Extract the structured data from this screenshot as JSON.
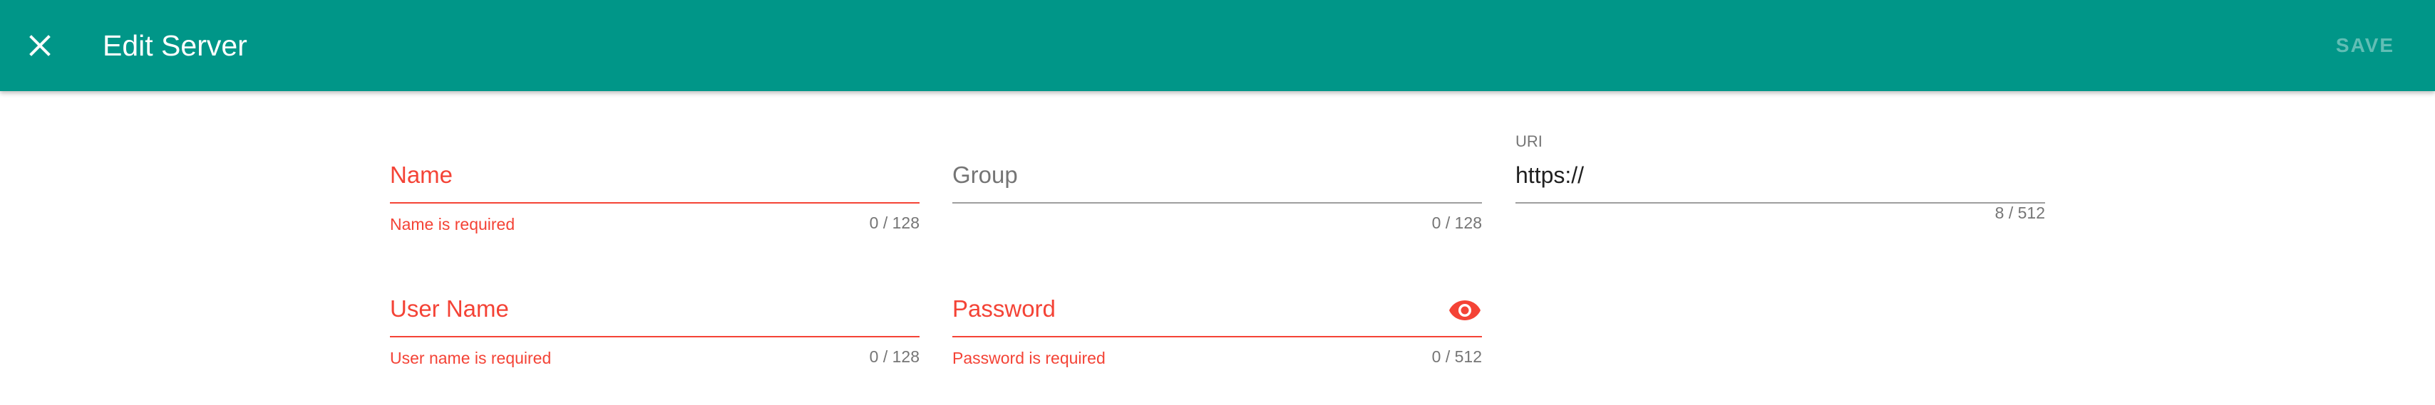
{
  "colors": {
    "toolbar": "#009688",
    "error": "#f44336",
    "label": "#757575",
    "text": "#212121"
  },
  "toolbar": {
    "close_icon": "close-icon",
    "title": "Edit Server",
    "save_label": "SAVE"
  },
  "form": {
    "name": {
      "label": "Name",
      "value": "",
      "error": "Name is required",
      "counter": "0 / 128"
    },
    "group": {
      "label": "Group",
      "value": "",
      "counter": "0 / 128"
    },
    "uri": {
      "label": "URI",
      "value": "https://",
      "counter": "8 / 512"
    },
    "username": {
      "label": "User Name",
      "value": "",
      "error": "User name is required",
      "counter": "0 / 128"
    },
    "password": {
      "label": "Password",
      "value": "",
      "error": "Password is required",
      "counter": "0 / 512",
      "toggle_icon": "eye-icon"
    }
  }
}
